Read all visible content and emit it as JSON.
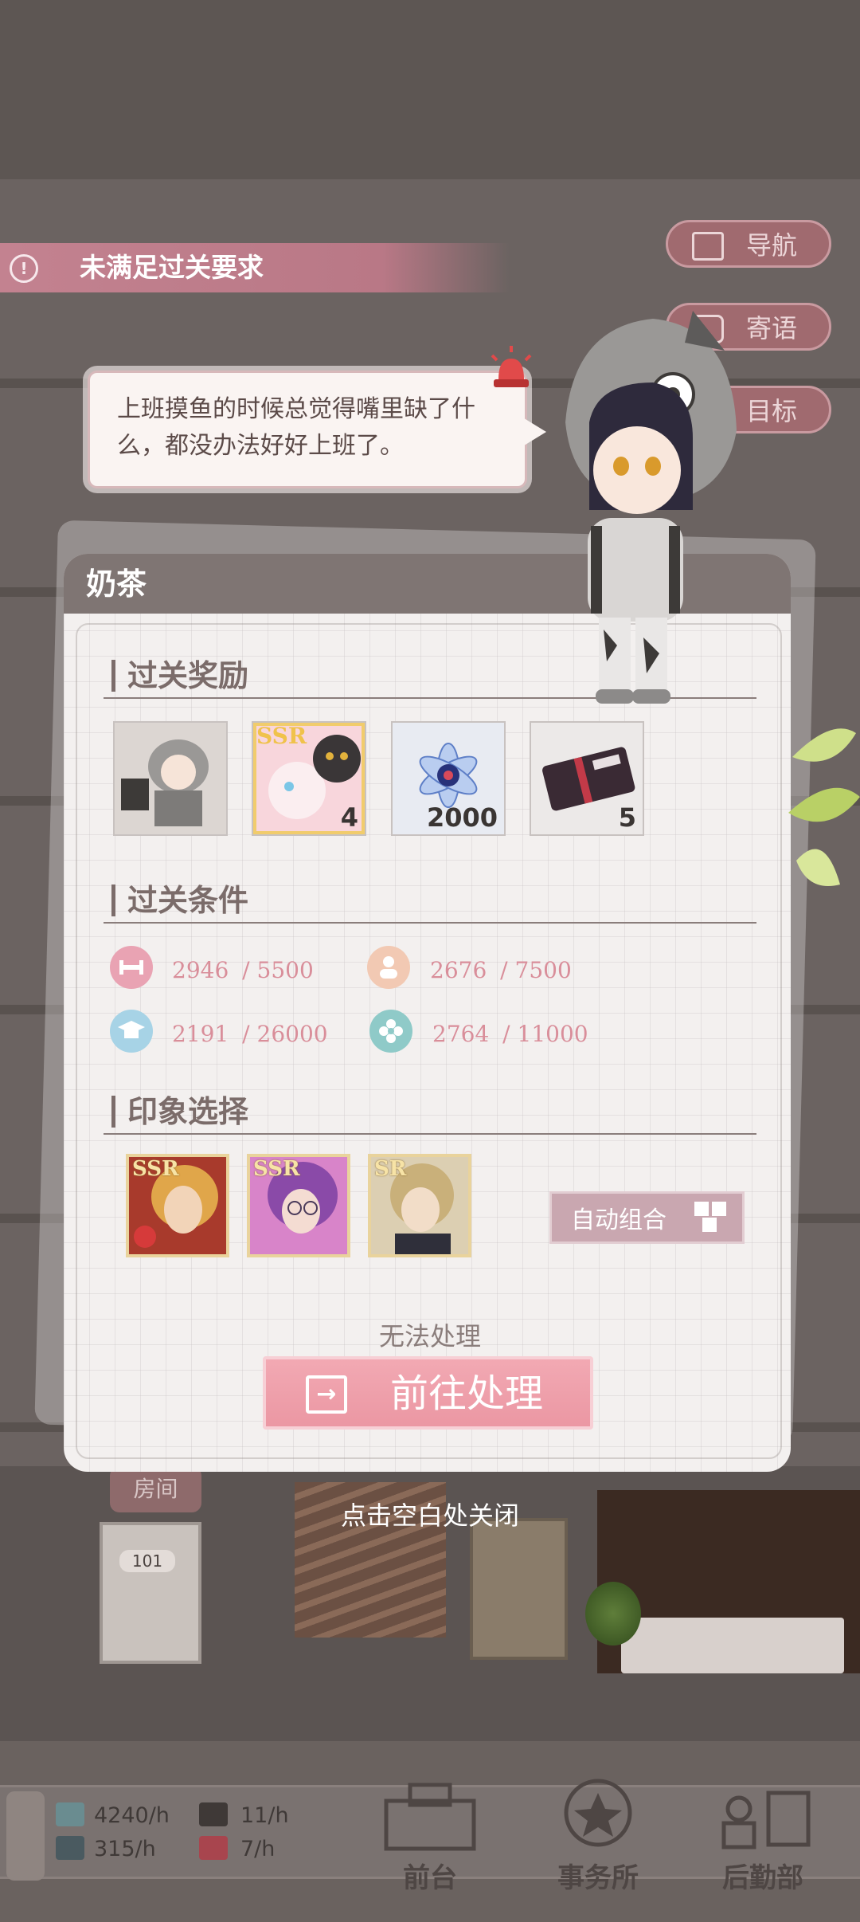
{
  "alert": {
    "icon": "exclamation-circle-icon",
    "text": "未满足过关要求"
  },
  "side_nav": [
    {
      "label": "导航",
      "icon": "map-icon"
    },
    {
      "label": "寄语",
      "icon": "message-icon"
    },
    {
      "label": "目标",
      "icon": "target-icon"
    }
  ],
  "speech_bubble": {
    "text": "上班摸鱼的时候总觉得嘴里缺了什么，都没办法好好上班了。"
  },
  "panel": {
    "title": "奶茶",
    "rewards_section": {
      "title": "过关奖励",
      "items": [
        {
          "name": "chibi-character-reward",
          "count": ""
        },
        {
          "name": "ssr-cats-card-reward",
          "badge": "SSR",
          "count": "4"
        },
        {
          "name": "crystal-flower-reward",
          "count": "2000"
        },
        {
          "name": "ticket-reward",
          "count": "5"
        }
      ]
    },
    "conditions_section": {
      "title": "过关条件",
      "items": [
        {
          "icon": "ability-icon",
          "color": "#e9a3b3",
          "current": "2946",
          "target": "/ 5500"
        },
        {
          "icon": "person-icon",
          "color": "#f2c9b3",
          "current": "2676",
          "target": "/ 7500"
        },
        {
          "icon": "education-icon",
          "color": "#a7d3e6",
          "current": "2191",
          "target": "/ 26000"
        },
        {
          "icon": "flower-icon",
          "color": "#8fcac8",
          "current": "2764",
          "target": "/ 11000"
        }
      ]
    },
    "impression_section": {
      "title": "印象选择",
      "cards": [
        {
          "rarity": "SSR",
          "name": "blond-character-card"
        },
        {
          "rarity": "SSR",
          "name": "purple-hair-character-card"
        },
        {
          "rarity": "SR",
          "name": "light-hair-character-card"
        }
      ],
      "auto_button": "自动组合"
    },
    "status_text": "无法处理",
    "go_button": "前往处理"
  },
  "close_hint": "点击空白处关闭",
  "background": {
    "room_sign": "房间",
    "door_number": "101"
  },
  "bottom_bar": {
    "resources": [
      {
        "icon": "money-icon",
        "value": "4240/h"
      },
      {
        "icon": "coffee-icon",
        "value": "11/h"
      },
      {
        "icon": "book-icon",
        "value": "315/h"
      },
      {
        "icon": "gift-icon",
        "value": "7/h"
      }
    ],
    "nav": [
      {
        "label": "前台",
        "icon": "front-desk-icon"
      },
      {
        "label": "事务所",
        "icon": "office-icon"
      },
      {
        "label": "后勤部",
        "icon": "logistics-icon"
      }
    ]
  },
  "colors": {
    "accent_pink": "#eb97a3",
    "header": "#7f7573",
    "alert": "#b97886"
  }
}
